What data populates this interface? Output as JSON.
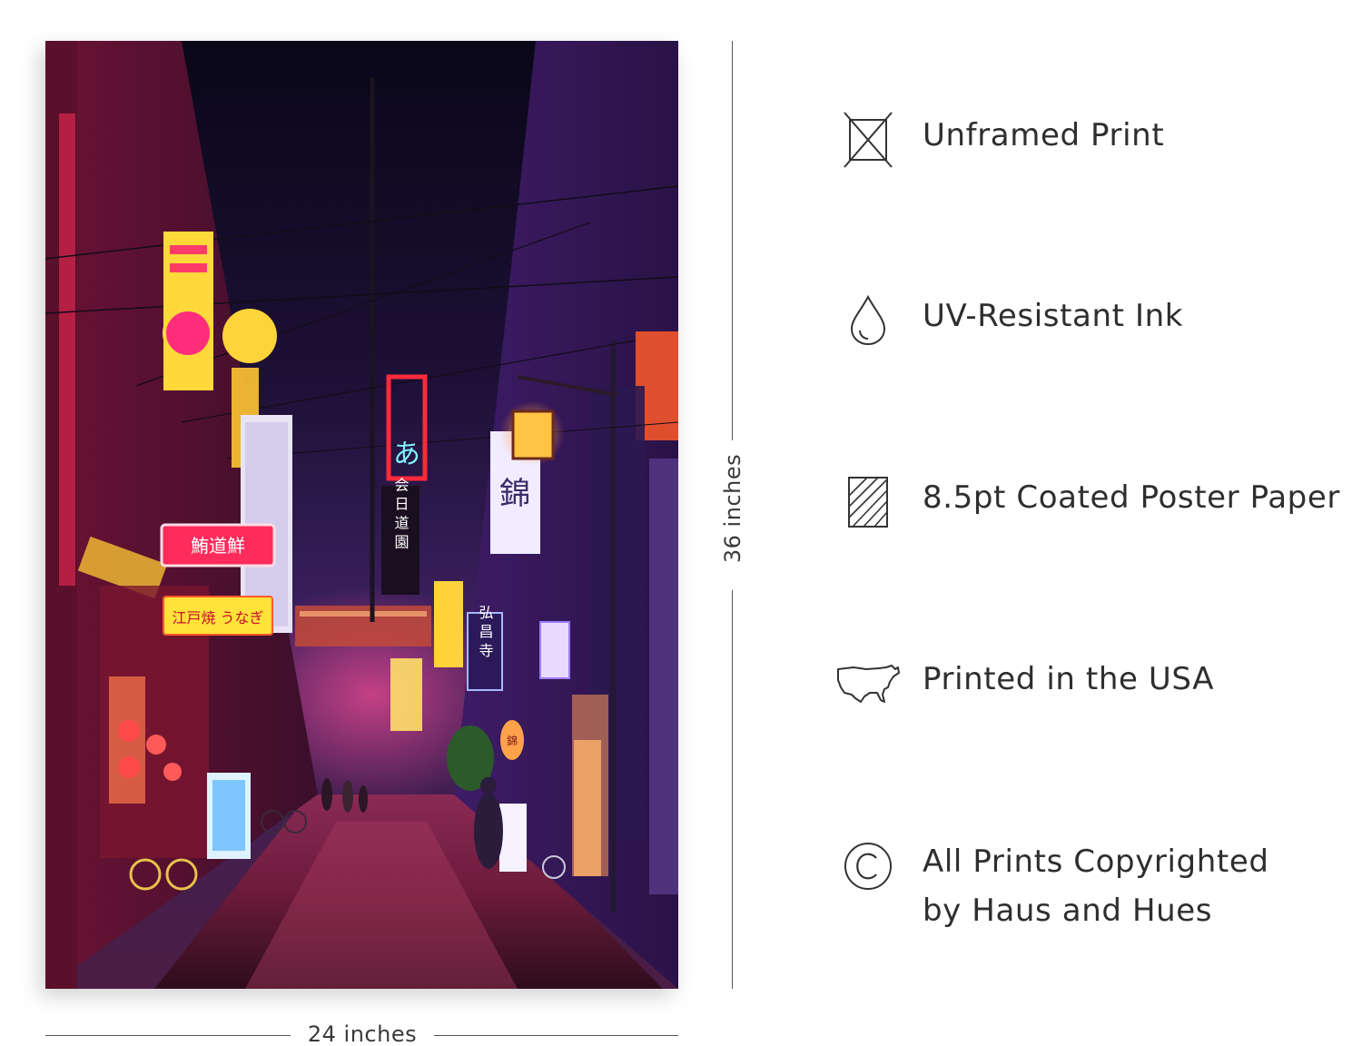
{
  "dimensions": {
    "height_label": "36 inches",
    "width_label": "24 inches"
  },
  "features": [
    {
      "icon": "unframed-box-icon",
      "lines": [
        "Unframed Print"
      ]
    },
    {
      "icon": "ink-drop-icon",
      "lines": [
        "UV-Resistant Ink"
      ]
    },
    {
      "icon": "paper-hatch-icon",
      "lines": [
        "8.5pt Coated Poster Paper"
      ]
    },
    {
      "icon": "usa-map-icon",
      "lines": [
        "Printed in the USA"
      ]
    },
    {
      "icon": "copyright-icon",
      "lines": [
        "All Prints Copyrighted",
        "by Haus and Hues"
      ]
    }
  ],
  "poster": {
    "signs": {
      "red_sign": "鮪道鮮",
      "yellow_sign": "江戸焼 うなぎ",
      "blue_sign_left": "あ",
      "vertical_sign": "会 日 道 園",
      "white_sign_right": "錦",
      "blue_sign_center": "弘 昌 寺",
      "lantern": "錦"
    }
  }
}
